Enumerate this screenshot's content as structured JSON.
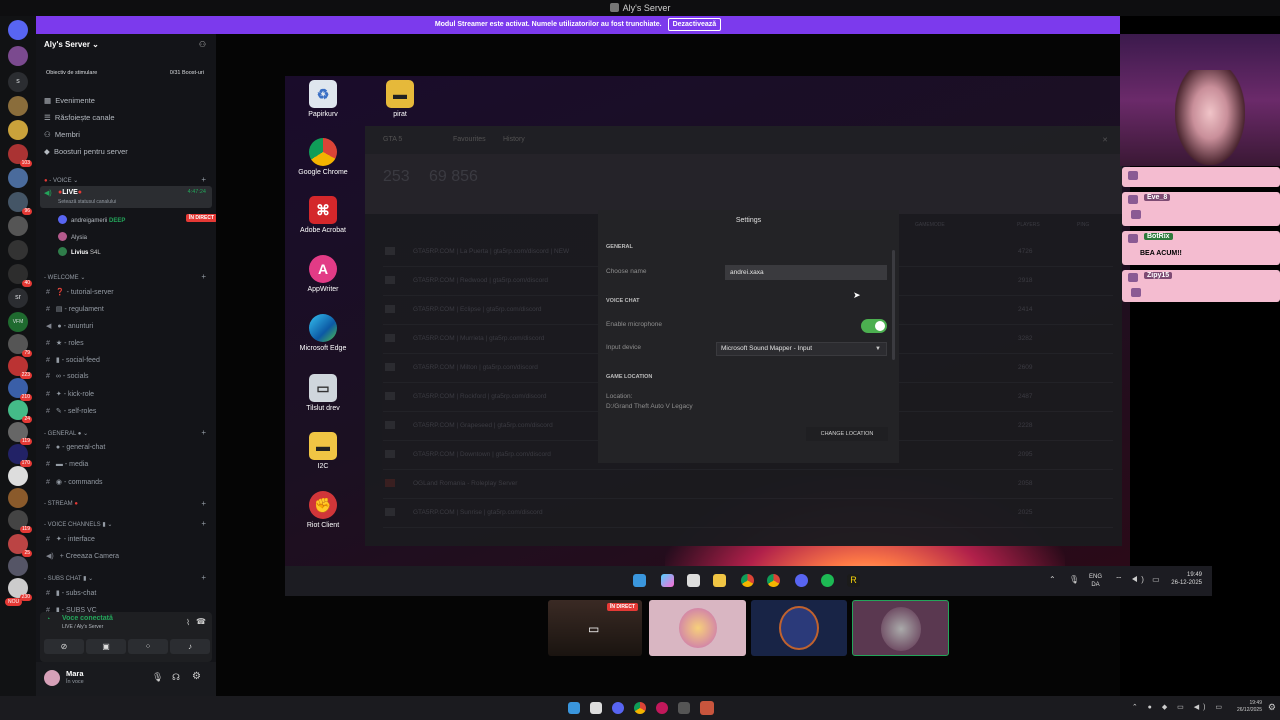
{
  "window": {
    "title": "Aly's Server"
  },
  "banner": {
    "text": "Modul Streamer este activat. Numele utilizatorilor au fost trunchiate.",
    "button": "Dezactivează"
  },
  "rail": {
    "badges": [
      "103",
      "96",
      "40",
      "79",
      "223",
      "210",
      "24",
      "119",
      "170",
      "119",
      "25",
      "230"
    ],
    "letters": [
      "s",
      "sr",
      "VFM"
    ],
    "new_label": "NOU"
  },
  "sidebar": {
    "server_name": "Aly's Server",
    "boost_goal": "Obiectiv de stimulare",
    "boost_progress": "0/31 Boost-uri",
    "menu": [
      "Evenimente",
      "Răsfoiește canale",
      "Membri",
      "Boosturi pentru server"
    ],
    "voice_category": "VOICE",
    "live_channel": "LIVE",
    "live_time": "4:47:24",
    "live_status": "Setează statusul canalului",
    "voice_users": [
      {
        "name": "andreigamerii",
        "tag": "DEEP",
        "badge": "ÎN DIRECT"
      },
      {
        "name": "Alysia"
      },
      {
        "name": "Livius",
        "tag": "S4L"
      }
    ],
    "welcome_category": "WELCOME",
    "welcome_channels": [
      "tutorial-server",
      "regulament",
      "anunturi",
      "roles",
      "social-feed",
      "socials",
      "kick-role",
      "self-roles"
    ],
    "general_category": "GENERAL",
    "general_channels": [
      "general-chat",
      "media",
      "commands"
    ],
    "stream_category": "STREAM",
    "voice_channels_category": "VOICE CHANNELS",
    "voice_channels": [
      "interface",
      "Creeaza Camera"
    ],
    "subs_category": "SUBS CHAT",
    "subs_channels": [
      "subs-chat",
      "SUBS VC"
    ],
    "voice_connected": "Voce conectată",
    "voice_connected_sub": "LIVE / Aly's Server",
    "user_name": "Mara",
    "user_status": "În voce"
  },
  "desktop": {
    "icons": [
      "Papirkurv",
      "pirat",
      "Google Chrome",
      "Adobe Acrobat",
      "AppWriter",
      "Microsoft Edge",
      "Tilslut drev",
      "I2C",
      "Riot Client"
    ]
  },
  "launcher": {
    "tabs": [
      "GTA 5",
      "Favourites",
      "History"
    ],
    "stats": [
      "253",
      "69 856"
    ],
    "col_players": "PLAYERS",
    "col_gamemode": "GAMEMODE",
    "col_ping": "PING",
    "servers": [
      {
        "name": "GTA5RP.COM | La Puerta | gta5rp.com/discord | NEW",
        "players": "4726"
      },
      {
        "name": "GTA5RP.COM | Redwood | gta5rp.com/discord",
        "players": "2918"
      },
      {
        "name": "GTA5RP.COM | Eclipse | gta5rp.com/discord",
        "players": "2414"
      },
      {
        "name": "GTA5RP.COM | Murrieta | gta5rp.com/discord",
        "players": "3282"
      },
      {
        "name": "GTA5RP.COM | Milton | gta5rp.com/discord",
        "players": "2609"
      },
      {
        "name": "GTA5RP.COM | Rockford | gta5rp.com/discord",
        "players": "2487"
      },
      {
        "name": "GTA5RP.COM | Grapeseed | gta5rp.com/discord",
        "players": "2228"
      },
      {
        "name": "GTA5RP.COM | Downtown | gta5rp.com/discord",
        "players": "2095"
      },
      {
        "name": "OGLand Romania - Roleplay Server",
        "players": "2058"
      },
      {
        "name": "GTA5RP.COM | Sunrise | gta5rp.com/discord",
        "players": "2025"
      }
    ]
  },
  "settings": {
    "title": "Settings",
    "general_header": "GENERAL",
    "name_label": "Choose name",
    "name_value": "andrei.xaxa",
    "voice_header": "VOICE CHAT",
    "mic_label": "Enable microphone",
    "mic_enabled": true,
    "device_label": "Input device",
    "device_value": "Microsoft Sound Mapper - Input",
    "location_header": "GAME LOCATION",
    "location_label": "Location:",
    "location_value": "D:/Grand Theft Auto V Legacy",
    "change_button": "CHANGE LOCATION"
  },
  "stream_taskbar": {
    "lang": "ENG",
    "lang2": "DA",
    "time": "19:49",
    "date": "26-12-2025"
  },
  "thumbs": {
    "live_badge": "ÎN DIRECT"
  },
  "chat": [
    {
      "name": "",
      "msg": ""
    },
    {
      "name": "Eve_8",
      "msg": ""
    },
    {
      "name": "BotRix",
      "msg": "BEA ACUM!!"
    },
    {
      "name": "Zipy15",
      "msg": ""
    }
  ],
  "taskbar": {
    "time": "19:49",
    "date": "26/12/2025"
  }
}
